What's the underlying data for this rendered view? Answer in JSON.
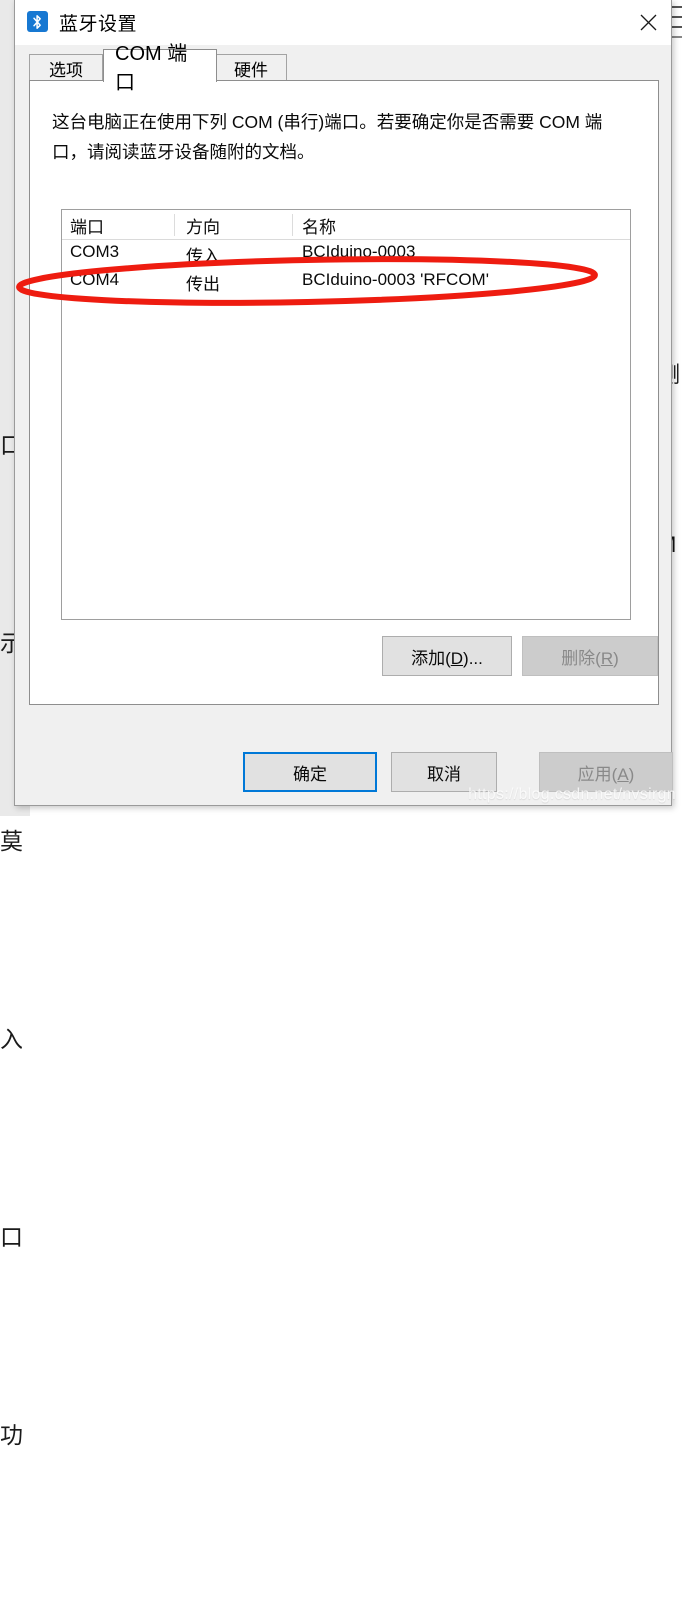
{
  "window": {
    "title": "蓝牙设置",
    "icon": "bluetooth-icon",
    "close_label": "✕"
  },
  "tabs": [
    {
      "label": "选项",
      "active": false
    },
    {
      "label": "COM 端口",
      "active": true
    },
    {
      "label": "硬件",
      "active": false
    }
  ],
  "page": {
    "description": "这台电脑正在使用下列 COM (串行)端口。若要确定你是否需要 COM 端口，请阅读蓝牙设备随附的文档。"
  },
  "port_table": {
    "columns": [
      "端口",
      "方向",
      "名称"
    ],
    "rows": [
      {
        "port": "COM3",
        "direction": "传入",
        "name": "BCIduino-0003"
      },
      {
        "port": "COM4",
        "direction": "传出",
        "name": "BCIduino-0003 'RFCOM'"
      }
    ]
  },
  "list_buttons": {
    "add": "添加(D)...",
    "add_prefix": "添加(",
    "add_accel": "D",
    "add_suffix": ")...",
    "remove": "删除(R)",
    "remove_prefix": "删除(",
    "remove_accel": "R",
    "remove_suffix": ")",
    "remove_enabled": false
  },
  "dialog_buttons": {
    "ok": "确定",
    "cancel": "取消",
    "apply": "应用(A)",
    "apply_prefix": "应用(",
    "apply_accel": "A",
    "apply_suffix": ")",
    "apply_enabled": false
  },
  "annotation": {
    "shape": "red-ellipse",
    "color": "#ee1c10",
    "target_row": "COM4"
  },
  "watermark": {
    "text": "https://blog.csdn.net/nvsirgn"
  },
  "background": {
    "left_glyphs": [
      "口",
      "示",
      "莫",
      "入",
      "口",
      "功"
    ],
    "right_glyphs": [
      "测",
      "M"
    ]
  },
  "colors": {
    "accent": "#0078d7",
    "title_icon_bg": "#1778d2",
    "dialog_bg": "#f0f0f0",
    "annotation_red": "#ee1c10"
  }
}
